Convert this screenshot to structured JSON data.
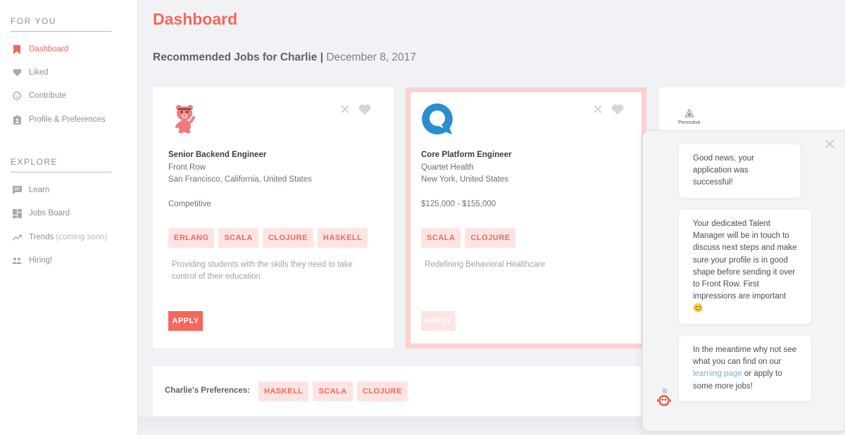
{
  "sidebar": {
    "for_you_title": "FOR YOU",
    "explore_title": "EXPLORE",
    "for_you_items": [
      {
        "label": "Dashboard",
        "icon": "bookmark-icon",
        "active": true
      },
      {
        "label": "Liked",
        "icon": "heart-icon"
      },
      {
        "label": "Contribute",
        "icon": "smiley-icon"
      },
      {
        "label": "Profile & Preferences",
        "icon": "clipboard-icon"
      }
    ],
    "explore_items": [
      {
        "label": "Learn",
        "icon": "chat-icon"
      },
      {
        "label": "Jobs Board",
        "icon": "grid-icon"
      },
      {
        "label": "Trends",
        "suffix": "(coming soon)",
        "icon": "trend-icon"
      },
      {
        "label": "Hiring!",
        "icon": "people-icon"
      }
    ]
  },
  "main": {
    "title": "Dashboard",
    "subtitle_bold": "Recommended Jobs for Charlie",
    "subtitle_sep": "|",
    "subtitle_date": "December 8, 2017"
  },
  "jobs": [
    {
      "title": "Senior Backend Engineer",
      "company": "Front Row",
      "location": "San Francisco, California, United States",
      "salary": "Competitive",
      "tags": [
        "ERLANG",
        "SCALA",
        "CLOJURE",
        "HASKELL"
      ],
      "description": "Providing students with the skills they need to take control of their education",
      "apply_label": "APPLY",
      "logo": "bear-logo"
    },
    {
      "title": "Core Platform Engineer",
      "company": "Quartet Health",
      "location": "New York, United States",
      "salary": "$125,000 - $155,000",
      "tags": [
        "SCALA",
        "CLOJURE"
      ],
      "description": "Redefining Behavioral Healthcare",
      "apply_label": "APPLY",
      "logo": "speech-bubble-logo"
    },
    {
      "company_logo_text": "Permutive",
      "logo": "permutive-logo"
    }
  ],
  "preferences": {
    "label": "Charlie's Preferences:",
    "tags": [
      "HASKELL",
      "SCALA",
      "CLOJURE"
    ]
  },
  "chat": {
    "messages": [
      "Good news, your application was successful!",
      "Your dedicated Talent Manager will be in touch to discuss next steps and make sure your profile is in good shape before sending it over to Front Row. First impressions are important",
      "In the meantime why not see what you can find on our"
    ],
    "emoji": "😊",
    "link_text": "learning page",
    "after_link": "or apply to some more jobs!"
  },
  "colors": {
    "accent": "#f6675a",
    "tag_bg": "#fde4e2",
    "highlight_border": "#fcd2d0",
    "quartet_blue": "#2a8ed0"
  }
}
